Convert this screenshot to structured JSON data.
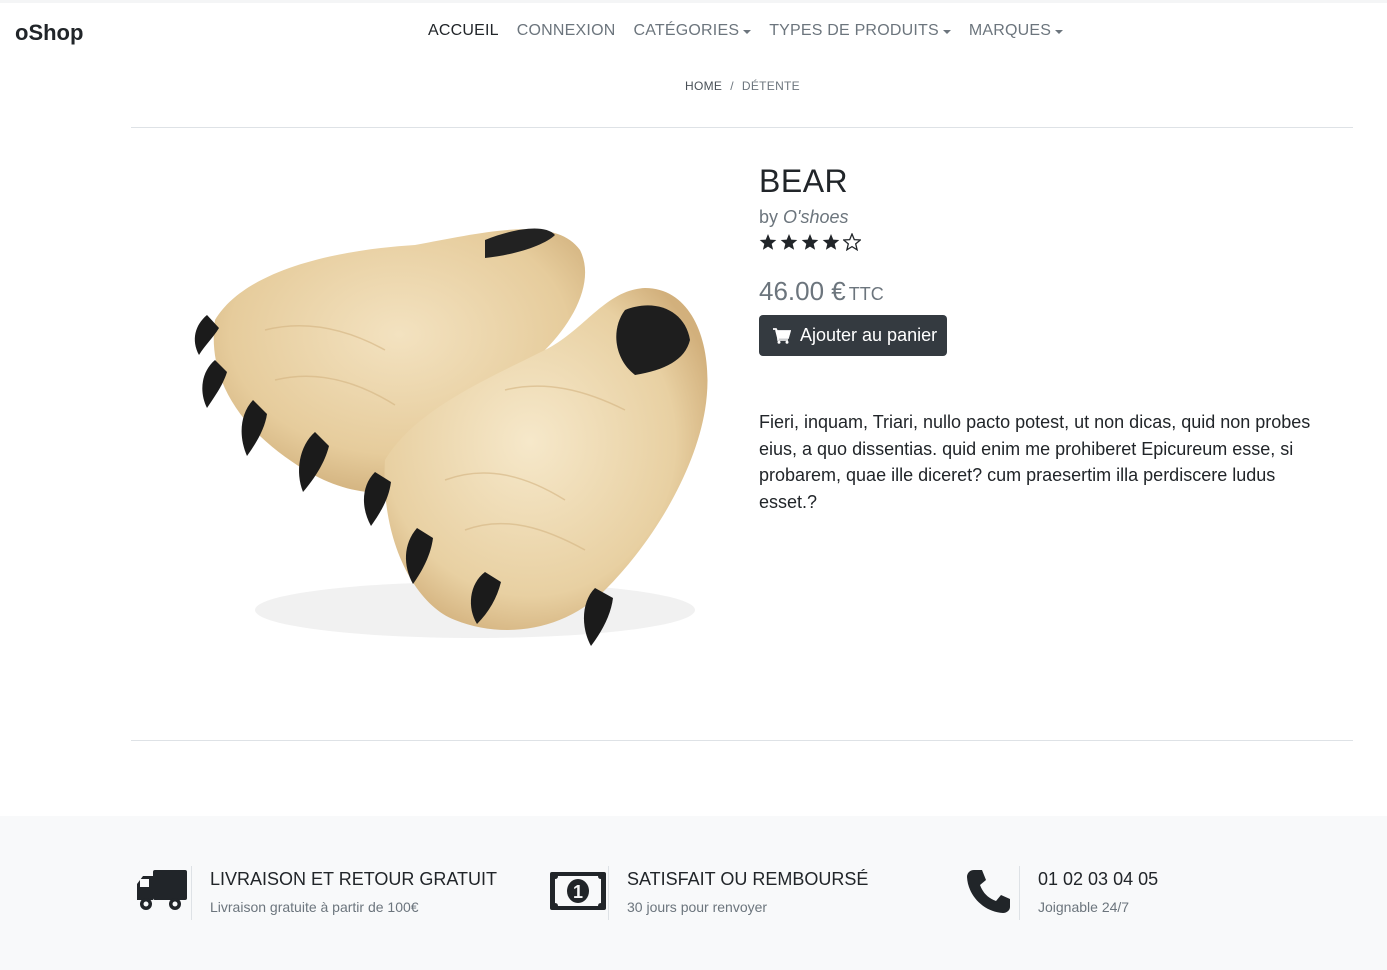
{
  "brand": "oShop",
  "nav": {
    "home": "ACCUEIL",
    "login": "CONNEXION",
    "categories": "CATÉGORIES",
    "types": "TYPES DE PRODUITS",
    "brands": "MARQUES"
  },
  "breadcrumb": {
    "home": "HOME",
    "sep": "/",
    "current": "DÉTENTE"
  },
  "product": {
    "name": "BEAR",
    "by": "by",
    "brand": "O'shoes",
    "rating": 4,
    "rating_max": 5,
    "price": "46.00 €",
    "tax": "TTC",
    "add_to_cart": "Ajouter au panier",
    "description": "Fieri, inquam, Triari, nullo pacto potest, ut non dicas, quid non probes eius, a quo dissentias. quid enim me prohiberet Epicureum esse, si probarem, quae ille diceret? cum praesertim illa perdiscere ludus esset.?",
    "image_icon": "bear-slippers-image"
  },
  "footer": {
    "features": [
      {
        "icon": "truck-icon",
        "title": "LIVRAISON ET RETOUR GRATUIT",
        "subtitle": "Livraison gratuite à partir de 100€"
      },
      {
        "icon": "money-icon",
        "title": "SATISFAIT OU REMBOURSÉ",
        "subtitle": "30 jours pour renvoyer"
      },
      {
        "icon": "phone-icon",
        "title": "01 02 03 04 05",
        "subtitle": "Joignable 24/7"
      }
    ]
  },
  "colors": {
    "dark": "#343a40",
    "muted": "#6c757d",
    "footer_bg": "#f8f9fa",
    "fur": "#e9d3a9"
  }
}
